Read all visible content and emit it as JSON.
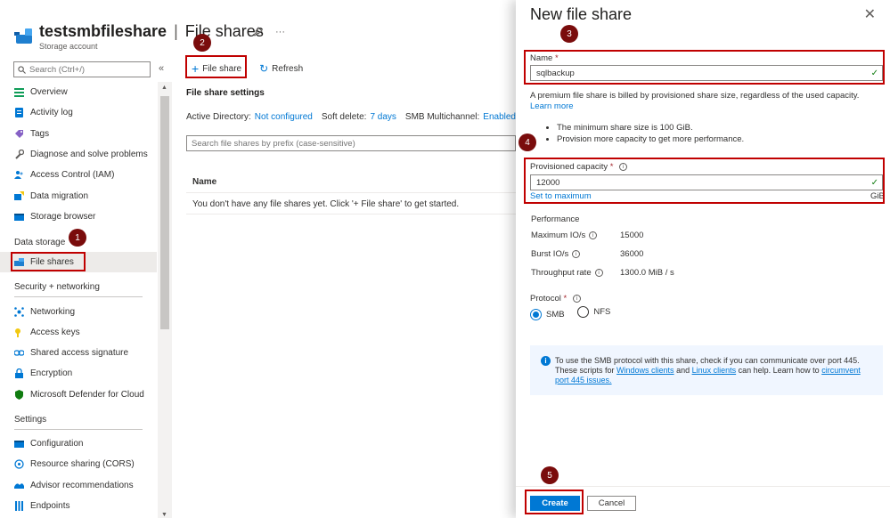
{
  "header": {
    "resource_name": "testsmbfileshare",
    "separator": "|",
    "page_title": "File shares",
    "subtitle": "Storage account",
    "pin_icon": "pin-icon",
    "more_icon": "more-icon"
  },
  "sidebar": {
    "search_placeholder": "Search (Ctrl+/)",
    "collapse_glyph": "«",
    "items_top": [
      {
        "label": "Overview",
        "icon": "overview-icon",
        "color": "#0f9d58"
      },
      {
        "label": "Activity log",
        "icon": "activity-log-icon",
        "color": "#0078d4"
      },
      {
        "label": "Tags",
        "icon": "tag-icon",
        "color": "#8661c5"
      },
      {
        "label": "Diagnose and solve problems",
        "icon": "wrench-icon",
        "color": "#605e5c"
      },
      {
        "label": "Access Control (IAM)",
        "icon": "people-icon",
        "color": "#0078d4"
      },
      {
        "label": "Data migration",
        "icon": "data-migration-icon",
        "color": "#0078d4"
      },
      {
        "label": "Storage browser",
        "icon": "storage-browser-icon",
        "color": "#0078d4"
      }
    ],
    "section_data_storage": "Data storage",
    "file_shares": "File shares",
    "section_security": "Security + networking",
    "items_security": [
      {
        "label": "Networking",
        "icon": "networking-icon",
        "color": "#0078d4"
      },
      {
        "label": "Access keys",
        "icon": "key-icon",
        "color": "#f2c811"
      },
      {
        "label": "Shared access signature",
        "icon": "link-icon",
        "color": "#0078d4"
      },
      {
        "label": "Encryption",
        "icon": "lock-icon",
        "color": "#0078d4"
      },
      {
        "label": "Microsoft Defender for Cloud",
        "icon": "shield-icon",
        "color": "#107c10"
      }
    ],
    "section_settings": "Settings",
    "items_settings": [
      {
        "label": "Configuration",
        "icon": "configuration-icon",
        "color": "#0078d4"
      },
      {
        "label": "Resource sharing (CORS)",
        "icon": "cors-icon",
        "color": "#0078d4"
      },
      {
        "label": "Advisor recommendations",
        "icon": "advisor-icon",
        "color": "#0078d4"
      },
      {
        "label": "Endpoints",
        "icon": "endpoints-icon",
        "color": "#0078d4"
      }
    ]
  },
  "toolbar": {
    "add_label": "File share",
    "refresh_label": "Refresh"
  },
  "main": {
    "settings_title": "File share settings",
    "ad_label": "Active Directory:",
    "ad_value": "Not configured",
    "soft_delete_label": "Soft delete:",
    "soft_delete_value": "7 days",
    "smb_label": "SMB Multichannel:",
    "smb_value": "Enabled",
    "search_placeholder": "Search file shares by prefix (case-sensitive)",
    "col_name": "Name",
    "empty_message": "You don't have any file shares yet. Click '+ File share' to get started."
  },
  "blade": {
    "title": "New file share",
    "close_glyph": "✕",
    "name_label": "Name",
    "required_mark": "*",
    "name_value": "sqlbackup",
    "premium_note": "A premium file share is billed by provisioned share size, regardless of the used capacity.",
    "learn_more": "Learn more",
    "bullets": [
      "The minimum share size is 100 GiB.",
      "Provision more capacity to get more performance."
    ],
    "capacity_label": "Provisioned capacity",
    "capacity_value": "12000",
    "set_max": "Set to maximum",
    "unit": "GiB",
    "performance_title": "Performance",
    "perf": [
      {
        "label": "Maximum IO/s",
        "value": "15000"
      },
      {
        "label": "Burst IO/s",
        "value": "36000"
      },
      {
        "label": "Throughput rate",
        "value": "1300.0 MiB / s"
      }
    ],
    "protocol_label": "Protocol",
    "protocol_smb": "SMB",
    "protocol_nfs": "NFS",
    "protocol_selected": "SMB",
    "info_text_1": "To use the SMB protocol with this share, check if you can communicate over port 445. These scripts for ",
    "info_link_windows": "Windows clients",
    "info_text_2": " and ",
    "info_link_linux": "Linux clients",
    "info_text_3": " can help. Learn how to ",
    "info_link_circumvent": "circumvent port 445 issues.",
    "create_label": "Create",
    "cancel_label": "Cancel"
  },
  "annotations": [
    "1",
    "2",
    "3",
    "4",
    "5"
  ],
  "colors": {
    "accent": "#0078d4",
    "annotation_red": "#c00000",
    "badge_dark_red": "#7a0c0c",
    "valid_green": "#107c10"
  }
}
